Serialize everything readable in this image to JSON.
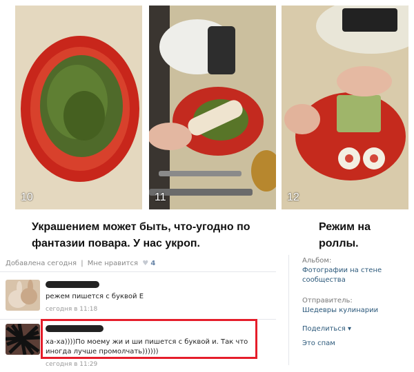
{
  "photos": [
    {
      "number": "10"
    },
    {
      "number": "11"
    },
    {
      "number": "12"
    }
  ],
  "captions": {
    "left": [
      "Украшением может быть, что-угодно по",
      "фантазии повара. У нас укроп."
    ],
    "right": [
      "Режим на",
      "роллы."
    ]
  },
  "post_meta": {
    "added": "Добавлена сегодня",
    "separator": "|",
    "like_label": "Мне нравится",
    "like_count": "4"
  },
  "comments": [
    {
      "text": "режем пишется с буквой Е",
      "time": "сегодня в 11:18"
    },
    {
      "text_lines": [
        "ха-ха))))По моему жи и ши пишется с буквой и. Так что",
        "иногда лучше промолчать))))))"
      ],
      "time": "сегодня в 11:29"
    }
  ],
  "sidebar": {
    "album_label": "Альбом:",
    "album_value": [
      "Фотографии на стене",
      "сообщества"
    ],
    "sender_label": "Отправитель:",
    "sender_value": "Шедевры кулинарии",
    "share": "Поделиться ▾",
    "spam": "Это спам"
  },
  "colors": {
    "highlight": "#e51d2a",
    "link": "#2b587a"
  }
}
